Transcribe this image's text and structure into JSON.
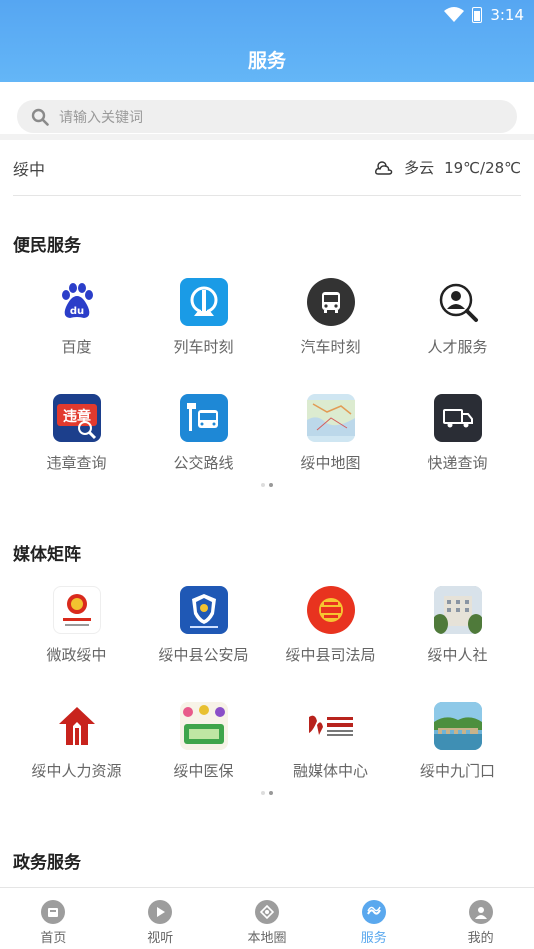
{
  "status": {
    "time": "3:14"
  },
  "header": {
    "title": "服务"
  },
  "search": {
    "placeholder": "请输入关键词"
  },
  "weather": {
    "city": "绥中",
    "condition": "多云",
    "temp": "19℃/28℃"
  },
  "sections": {
    "convenience": {
      "title": "便民服务",
      "items": [
        {
          "label": "百度",
          "icon": "baidu-icon"
        },
        {
          "label": "列车时刻",
          "icon": "train-icon"
        },
        {
          "label": "汽车时刻",
          "icon": "bus-icon"
        },
        {
          "label": "人才服务",
          "icon": "person-search-icon"
        },
        {
          "label": "违章查询",
          "icon": "violation-icon"
        },
        {
          "label": "公交路线",
          "icon": "bus-stop-icon"
        },
        {
          "label": "绥中地图",
          "icon": "map-icon"
        },
        {
          "label": "快递查询",
          "icon": "delivery-truck-icon"
        }
      ]
    },
    "media": {
      "title": "媒体矩阵",
      "items": [
        {
          "label": "微政绥中",
          "icon": "gov-emblem-icon"
        },
        {
          "label": "绥中县公安局",
          "icon": "police-badge-icon"
        },
        {
          "label": "绥中县司法局",
          "icon": "justice-logo-icon"
        },
        {
          "label": "绥中人社",
          "icon": "building-photo-icon"
        },
        {
          "label": "绥中人力资源",
          "icon": "hr-logo-icon"
        },
        {
          "label": "绥中医保",
          "icon": "medical-insurance-icon"
        },
        {
          "label": "融媒体中心",
          "icon": "media-center-logo-icon"
        },
        {
          "label": "绥中九门口",
          "icon": "jiumenkou-photo-icon"
        }
      ]
    },
    "government": {
      "title": "政务服务"
    }
  },
  "tabs": [
    {
      "label": "首页"
    },
    {
      "label": "视听"
    },
    {
      "label": "本地圈"
    },
    {
      "label": "服务"
    },
    {
      "label": "我的"
    }
  ],
  "colors": {
    "header": "#5aa8f0",
    "accent": "#5aa8ee"
  }
}
